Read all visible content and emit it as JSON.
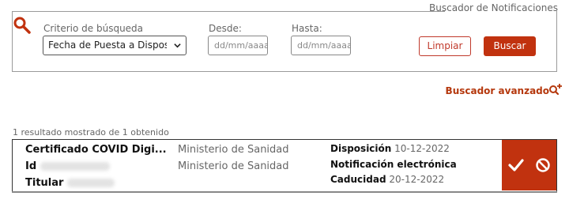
{
  "panel": {
    "legend": "Buscador de Notificaciones",
    "criterio_label": "Criterio de búsqueda",
    "criterio_value": "Fecha de Puesta a Disposición",
    "desde_label": "Desde:",
    "desde_placeholder": "dd/mm/aaaa",
    "hasta_label": "Hasta:",
    "hasta_placeholder": "dd/mm/aaaa",
    "clear_label": "Limpiar",
    "search_label": "Buscar",
    "advanced_label": "Buscador avanzado"
  },
  "results": {
    "count_text": "1 resultado mostrado de 1 obtenido",
    "items": [
      {
        "title": "Certificado COVID Digi...",
        "id_label": "Id",
        "titular_label": "Titular",
        "emisor": "Ministerio de Sanidad",
        "destinatario": "Ministerio de Sanidad",
        "disposicion_label": "Disposición",
        "disposicion_date": "10-12-2022",
        "tipo": "Notificación electrónica",
        "caducidad_label": "Caducidad",
        "caducidad_date": "20-12-2022"
      }
    ]
  },
  "colors": {
    "accent": "#c1320f",
    "border": "#9a9a9a"
  },
  "icons": [
    "search-icon",
    "chevron-down-icon",
    "advanced-search-icon",
    "check-icon",
    "block-icon"
  ]
}
